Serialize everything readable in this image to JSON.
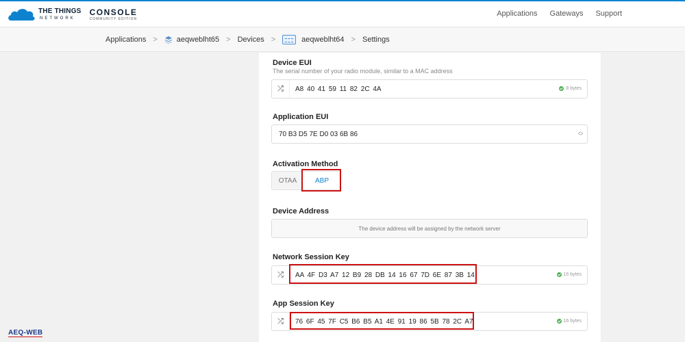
{
  "header": {
    "brand_line1": "THE THINGS",
    "brand_line2": "NETWORK",
    "console_title": "CONSOLE",
    "console_edition": "COMMUNITY EDITION",
    "nav": [
      "Applications",
      "Gateways",
      "Support"
    ]
  },
  "breadcrumb": {
    "applications": "Applications",
    "app_id": "aeqweblht65",
    "devices": "Devices",
    "device_id": "aeqweblht64",
    "settings": "Settings"
  },
  "form": {
    "device_eui": {
      "title": "Device EUI",
      "description": "The serial number of your radio module, similar to a MAC address",
      "value": "A8 40 41 59 11 82 2C 4A",
      "bytes": "8 bytes"
    },
    "app_eui": {
      "title": "Application EUI",
      "value": "70 B3 D5 7E D0 03 6B 86"
    },
    "activation": {
      "title": "Activation Method",
      "options": [
        "OTAA",
        "ABP"
      ],
      "selected": "ABP"
    },
    "device_address": {
      "title": "Device Address",
      "placeholder": "The device address will be assigned by the network server"
    },
    "nwk_skey": {
      "title": "Network Session Key",
      "value": "AA 4F D3 A7 12 B9 28 DB 14 16 67 7D 6E 87 3B 14",
      "bytes": "16 bytes"
    },
    "app_skey": {
      "title": "App Session Key",
      "value": "76 6F 45 7F C5 B6 B5 A1 4E 91 19 86 5B 78 2C A7",
      "bytes": "16 bytes"
    }
  },
  "watermark": "AEQ-WEB",
  "colors": {
    "accent": "#0d83d0",
    "highlight": "#cc1111",
    "ok": "#4caf50"
  }
}
